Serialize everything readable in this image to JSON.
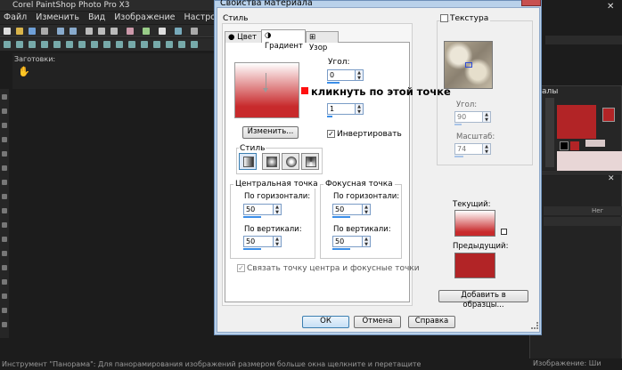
{
  "background_app": {
    "title": "Corel PaintShop Photo Pro X3",
    "menu": [
      "Файл",
      "Изменить",
      "Вид",
      "Изображение",
      "Настройка"
    ],
    "presets_label": "Заготовки:",
    "status_text": "Инструмент \"Панорама\": Для панорамирования изображений размером больше окна щелкните и перетащите",
    "status_right": "Изображение: Ши",
    "materials_panel_title": "алы",
    "layer_name": "Нег"
  },
  "dialog": {
    "title": "Свойства материала",
    "style_label": "Стиль",
    "tabs": [
      {
        "label": "Цвет",
        "icon": "color-circle-icon"
      },
      {
        "label": "Градиент",
        "icon": "gradient-circle-icon"
      },
      {
        "label": "Узор",
        "icon": "pattern-grid-icon"
      }
    ],
    "active_tab": "Градиент",
    "angle_label": "Угол:",
    "angle_value": "0",
    "repeats_value": "1",
    "edit_button": "Изменить...",
    "invert_label": "Инвертировать",
    "invert_checked": true,
    "style_group_label": "Стиль",
    "center_point": {
      "title": "Центральная точка",
      "h_label": "По горизонтали:",
      "h_value": "50",
      "v_label": "По вертикали:",
      "v_value": "50"
    },
    "focal_point": {
      "title": "Фокусная точка",
      "h_label": "По горизонтали:",
      "h_value": "50",
      "v_label": "По вертикали:",
      "v_value": "50"
    },
    "link_label": "Связать точку центра и фокусные точки",
    "link_checked": true,
    "texture": {
      "label": "Текстура",
      "checked": false,
      "angle_label": "Угол:",
      "angle_value": "90",
      "scale_label": "Масштаб:",
      "scale_value": "74"
    },
    "current_label": "Текущий:",
    "previous_label": "Предыдущий:",
    "add_to_swatches": "Добавить в образцы...",
    "ok": "ОК",
    "cancel": "Отмена",
    "help": "Справка",
    "check_mark": "✓"
  },
  "annotation": {
    "text": "кликнуть по этой точке",
    "marker_color": "#ff1010"
  },
  "colors": {
    "gradient_red": "#c82a2c",
    "swatch_red": "#b22426"
  }
}
